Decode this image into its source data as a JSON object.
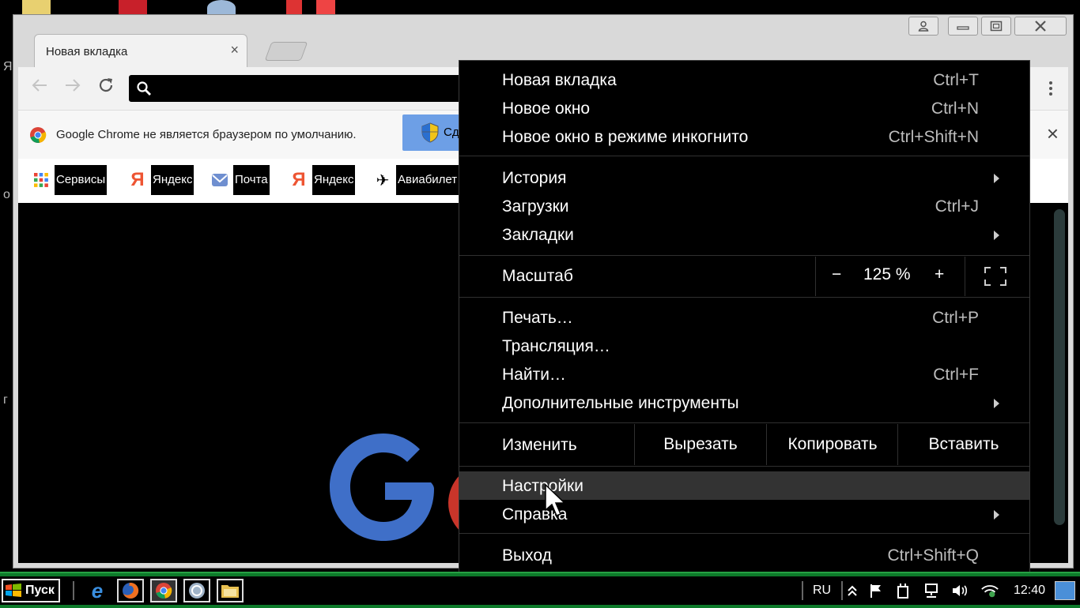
{
  "window": {
    "tab_title": "Новая вкладка",
    "tab_close": "×"
  },
  "infobar": {
    "text": "Google Chrome не является браузером по умолчанию.",
    "button_label": "Сд",
    "close": "×"
  },
  "bookmarks": [
    {
      "label": "Сервисы",
      "icon": "apps-grid-icon"
    },
    {
      "label": "Яндекс",
      "icon": "yandex-icon"
    },
    {
      "label": "Почта",
      "icon": "mail-icon"
    },
    {
      "label": "Яндекс",
      "icon": "yandex-icon"
    },
    {
      "label": "Авиабилет",
      "icon": "plane-icon"
    }
  ],
  "menu": {
    "items": [
      {
        "label": "Новая вкладка",
        "shortcut": "Ctrl+T"
      },
      {
        "label": "Новое окно",
        "shortcut": "Ctrl+N"
      },
      {
        "label": "Новое окно в режиме инкогнито",
        "shortcut": "Ctrl+Shift+N"
      },
      {
        "label": "История",
        "shortcut": ""
      },
      {
        "label": "Загрузки",
        "shortcut": "Ctrl+J"
      },
      {
        "label": "Закладки",
        "shortcut": ""
      },
      {
        "label": "Печать…",
        "shortcut": "Ctrl+P"
      },
      {
        "label": "Трансляция…",
        "shortcut": ""
      },
      {
        "label": "Найти…",
        "shortcut": "Ctrl+F"
      },
      {
        "label": "Дополнительные инструменты",
        "shortcut": ""
      },
      {
        "label": "Настройки",
        "shortcut": ""
      },
      {
        "label": "Справка",
        "shortcut": ""
      },
      {
        "label": "Выход",
        "shortcut": "Ctrl+Shift+Q"
      }
    ],
    "zoom": {
      "label": "Масштаб",
      "minus": "−",
      "value": "125 %",
      "plus": "+"
    },
    "edit": {
      "label": "Изменить",
      "cut": "Вырезать",
      "copy": "Копировать",
      "paste": "Вставить"
    }
  },
  "taskbar": {
    "start": "Пуск",
    "lang": "RU",
    "clock": "12:40"
  },
  "desktop": {
    "side_letters": [
      "Я",
      "о",
      "г"
    ]
  },
  "colors": {
    "taskbar_green": "#0d7a2a",
    "menu_bg": "#000000",
    "menu_highlight": "#333333",
    "infobar_button": "#6d9fe6",
    "google_blue": "#4285f4",
    "google_red": "#ea4335"
  }
}
